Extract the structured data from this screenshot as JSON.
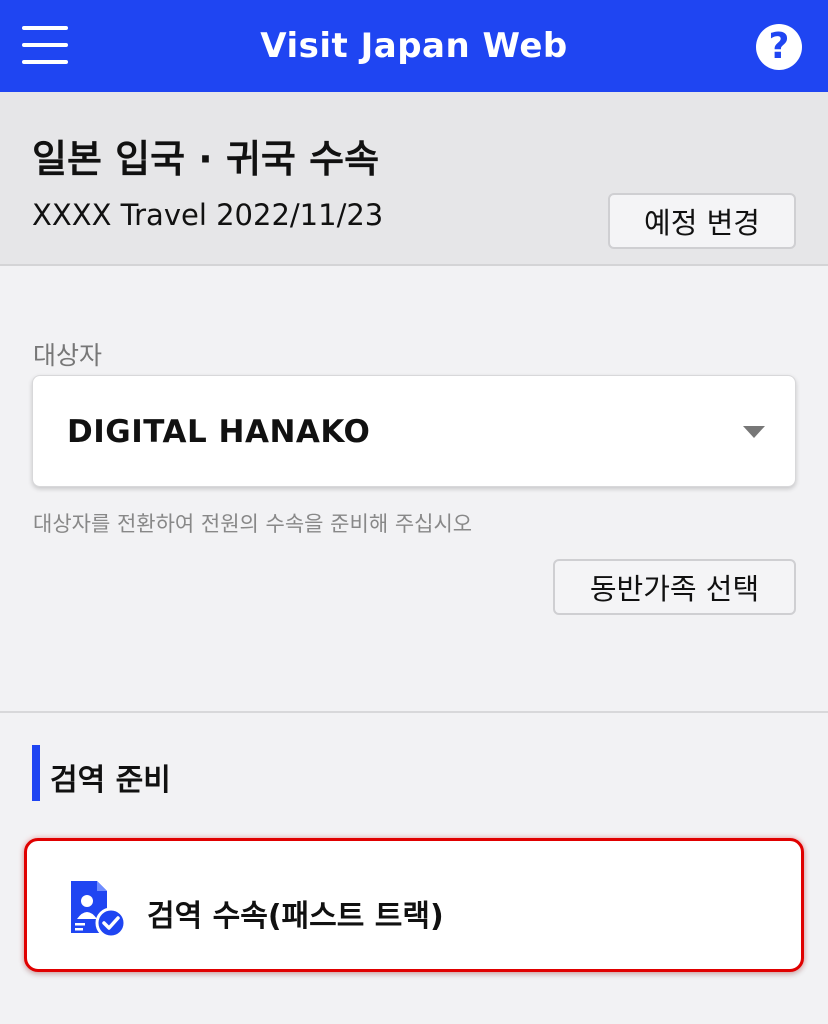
{
  "header": {
    "title": "Visit Japan Web",
    "menu_icon": "menu-icon",
    "help_icon": "help-icon",
    "help_glyph": "?",
    "brand_color": "#1f45f2"
  },
  "trip": {
    "title": "일본 입국 · 귀국 수속",
    "info": "XXXX Travel 2022/11/23",
    "change_button": "예정 변경"
  },
  "subject": {
    "label": "대상자",
    "selected": "DIGITAL HANAKO",
    "hint": "대상자를 전환하여 전원의 수속을 준비해 주십시오",
    "family_button": "동반가족 선택"
  },
  "quarantine": {
    "section_title": "검역 준비",
    "card_label": "검역 수속(패스트 트랙)",
    "card_icon": "document-check-icon",
    "highlight_color": "#e00000"
  }
}
